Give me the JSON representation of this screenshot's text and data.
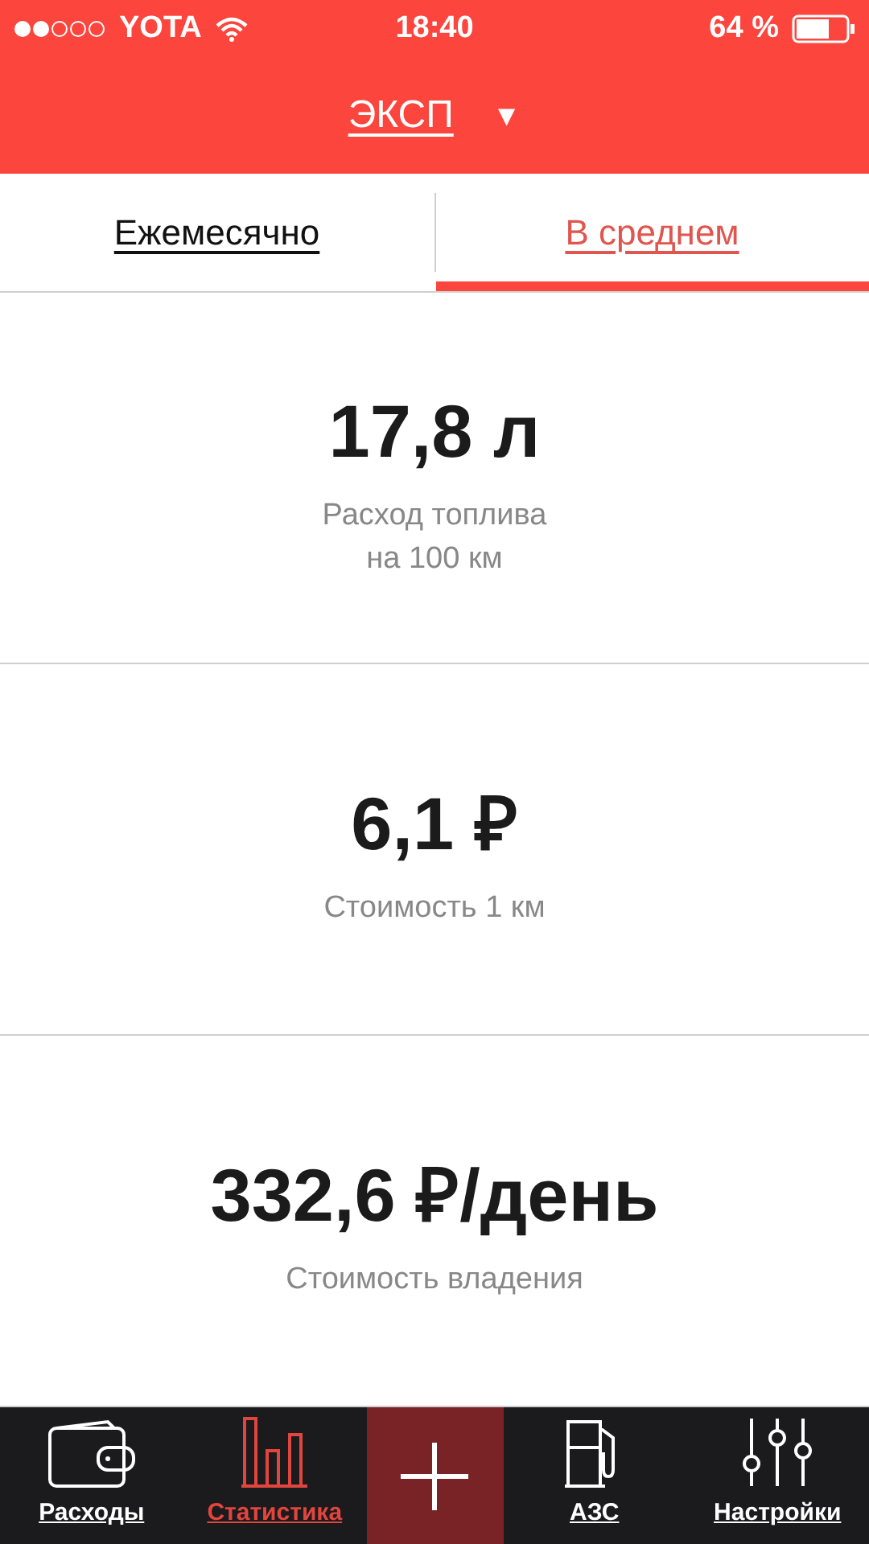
{
  "status_bar": {
    "carrier": "YOTA",
    "time": "18:40",
    "battery": "64 %"
  },
  "header": {
    "title": "ЭКСП",
    "caret": "▼"
  },
  "tabs": [
    {
      "label": "Ежемесячно",
      "selected": false
    },
    {
      "label": "В среднем",
      "selected": true
    }
  ],
  "stats": [
    {
      "value": "17,8 л",
      "caption": "Расход топлива\nна 100 км"
    },
    {
      "value": "6,1 ₽",
      "caption": "Стоимость 1 км"
    },
    {
      "value": "332,6 ₽/день",
      "caption": "Стоимость владения"
    }
  ],
  "nav": [
    {
      "kind": "tab",
      "label": "Расходы",
      "selected": false
    },
    {
      "kind": "tab",
      "label": "Статистика",
      "selected": true
    },
    {
      "kind": "add"
    },
    {
      "kind": "tab",
      "label": "АЗС",
      "selected": false
    },
    {
      "kind": "tab",
      "label": "Настройки",
      "selected": false
    }
  ]
}
